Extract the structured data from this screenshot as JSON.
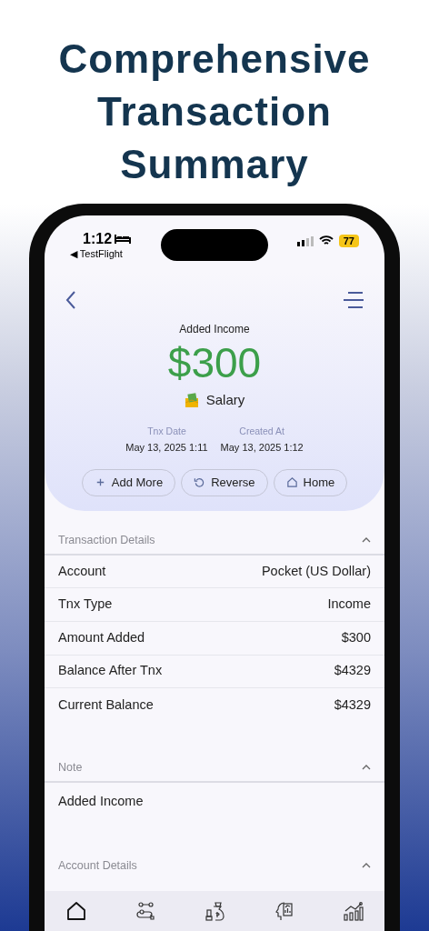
{
  "headline": [
    "Comprehensive",
    "Transaction",
    "Summary"
  ],
  "status_bar": {
    "time": "1:12",
    "back_app": "◀ TestFlight",
    "battery": "77"
  },
  "header": {
    "title": "Added Income",
    "amount": "$300",
    "category": "Salary",
    "dates": [
      {
        "label": "Tnx Date",
        "value": "May 13, 2025 1:11"
      },
      {
        "label": "Created At",
        "value": "May 13, 2025 1:12"
      }
    ],
    "actions": [
      {
        "kind": "add",
        "label": "Add More"
      },
      {
        "kind": "reverse",
        "label": "Reverse"
      },
      {
        "kind": "home",
        "label": "Home"
      }
    ]
  },
  "sections": [
    {
      "title": "Transaction Details",
      "expanded": true,
      "kind": "rows",
      "rows": [
        {
          "label": "Account",
          "value": "Pocket (US Dollar)"
        },
        {
          "label": "Tnx Type",
          "value": "Income"
        },
        {
          "label": "Amount Added",
          "value": "$300"
        },
        {
          "label": "Balance After Tnx",
          "value": "$4329"
        },
        {
          "label": "Current Balance",
          "value": "$4329"
        }
      ]
    },
    {
      "title": "Note",
      "expanded": true,
      "kind": "text",
      "text": "Added Income"
    },
    {
      "title": "Account Details",
      "expanded": true,
      "kind": "rows"
    }
  ],
  "tab_bar": [
    {
      "kind": "home",
      "selected": true
    },
    {
      "kind": "route",
      "selected": false
    },
    {
      "kind": "money",
      "selected": false
    },
    {
      "kind": "report",
      "selected": false
    },
    {
      "kind": "chart",
      "selected": false
    }
  ]
}
